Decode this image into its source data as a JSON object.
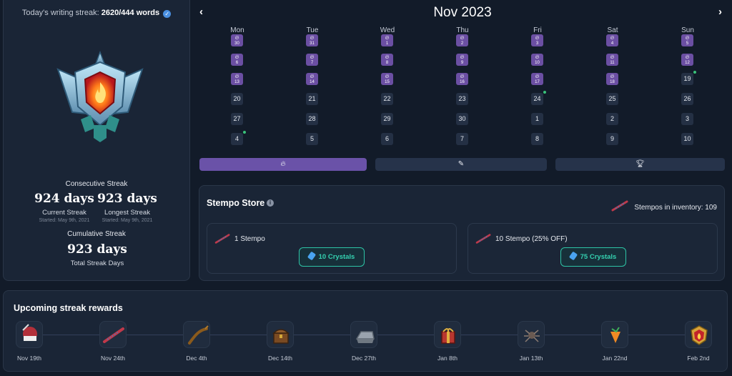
{
  "streak": {
    "today_label": "Today's writing streak:",
    "today_value": "2620/444 words",
    "consecutive_label": "Consecutive Streak",
    "current_days": "924 days",
    "current_label": "Current Streak",
    "current_started": "Started: May 9th, 2021",
    "longest_days": "923 days",
    "longest_label": "Longest Streak",
    "longest_started": "Started: May 9th, 2021",
    "cumulative_label": "Cumulative Streak",
    "total_days": "923 days",
    "total_label": "Total Streak Days"
  },
  "calendar": {
    "title": "Nov 2023",
    "weekdays": [
      "Mon",
      "Tue",
      "Wed",
      "Thu",
      "Fri",
      "Sat",
      "Sun"
    ],
    "weeks": [
      [
        "30",
        "31",
        "1",
        "2",
        "3",
        "4",
        "5"
      ],
      [
        "6",
        "7",
        "8",
        "9",
        "10",
        "11",
        "12"
      ],
      [
        "13",
        "14",
        "15",
        "16",
        "17",
        "18",
        "19"
      ],
      [
        "20",
        "21",
        "22",
        "23",
        "24",
        "25",
        "26"
      ],
      [
        "27",
        "28",
        "29",
        "30",
        "1",
        "2",
        "3"
      ],
      [
        "4",
        "5",
        "6",
        "7",
        "8",
        "9",
        "10"
      ]
    ],
    "streak_days": 20,
    "dot_cells": [
      [
        2,
        6
      ],
      [
        3,
        4
      ],
      [
        5,
        0
      ]
    ],
    "mode_icons": [
      "flame-icon",
      "pencil-icon",
      "trophy-icon"
    ],
    "active_mode": 0
  },
  "store": {
    "title": "Stempo Store",
    "inventory": "Stempos in inventory: 109",
    "items": [
      {
        "label": "1 Stempo",
        "price": "10 Crystals"
      },
      {
        "label": "10 Stempo (25% OFF)",
        "price": "75 Crystals"
      }
    ]
  },
  "rewards": {
    "title": "Upcoming streak rewards",
    "items": [
      {
        "date": "Nov 19th",
        "icon": "keep-writing-badge-icon"
      },
      {
        "date": "Nov 24th",
        "icon": "stempo-icon"
      },
      {
        "date": "Dec 4th",
        "icon": "branch-icon"
      },
      {
        "date": "Dec 14th",
        "icon": "treasure-chest-icon"
      },
      {
        "date": "Dec 27th",
        "icon": "ingot-icon"
      },
      {
        "date": "Jan 8th",
        "icon": "gift-box-icon"
      },
      {
        "date": "Jan 13th",
        "icon": "spider-icon"
      },
      {
        "date": "Jan 22nd",
        "icon": "crystal-icon"
      },
      {
        "date": "Feb 2nd",
        "icon": "flame-badge-icon"
      }
    ]
  },
  "colors": {
    "background": "#121b29",
    "panel": "#1a2536",
    "streak_purple": "#6b4fa3",
    "accent_teal": "#2ec4a6"
  }
}
